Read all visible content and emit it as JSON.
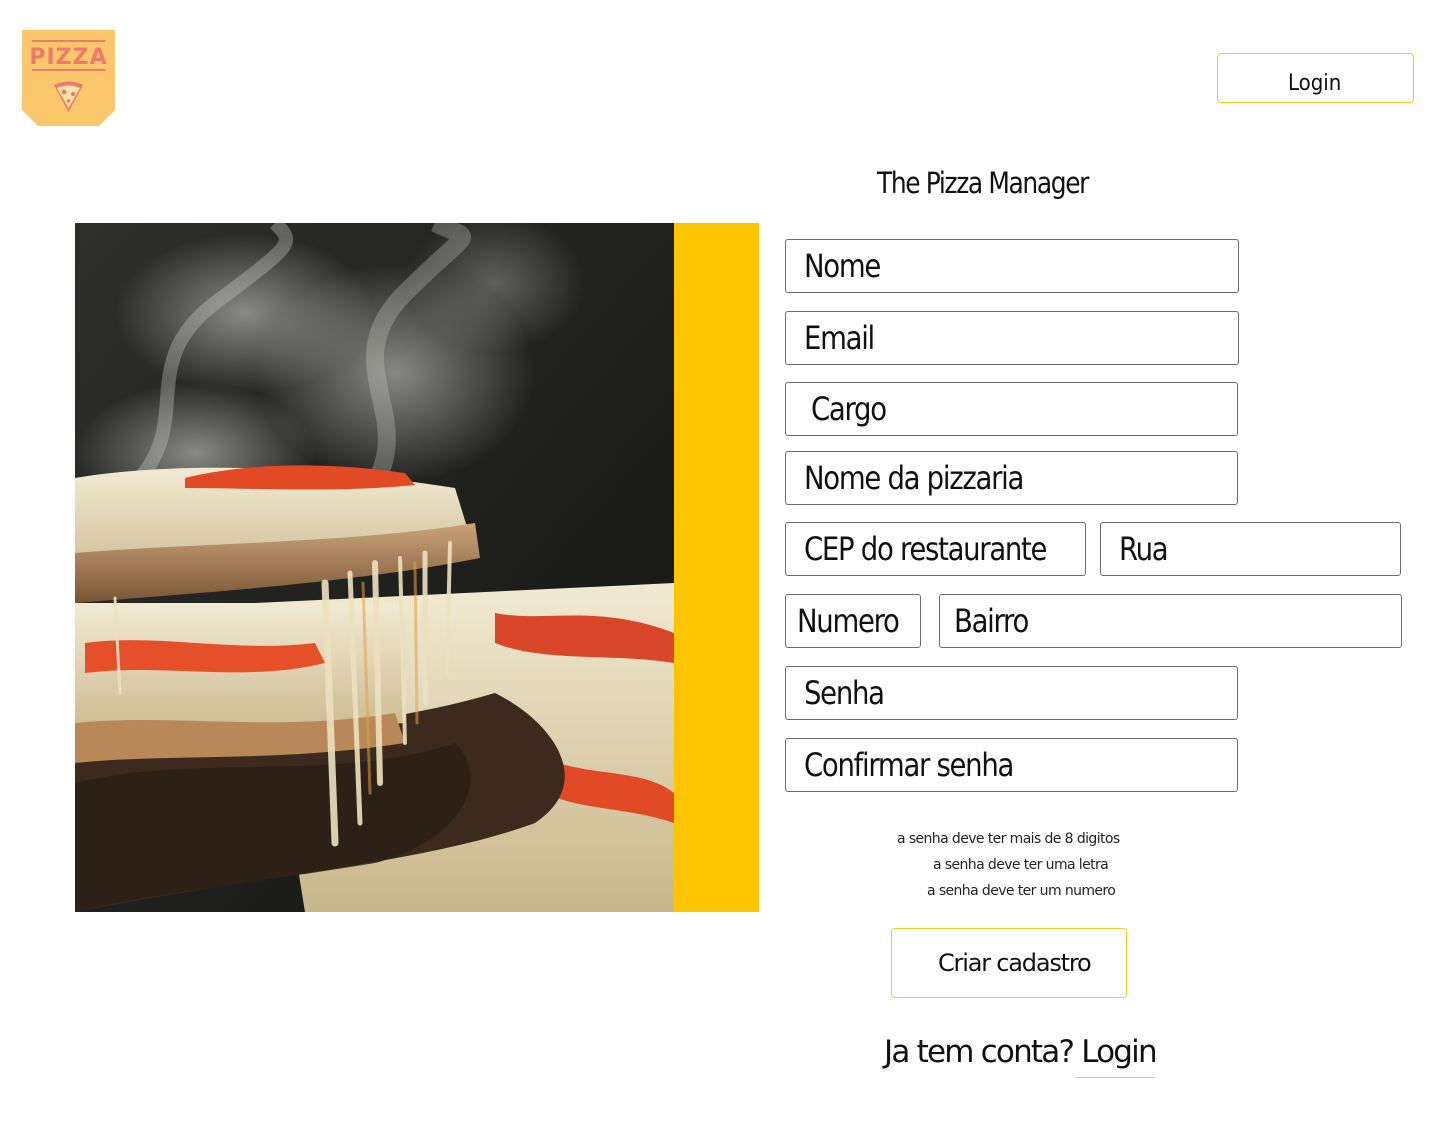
{
  "brand": {
    "logo_text": "PIZZA",
    "accent_color": "#fdc500",
    "button_border_color": "#f2cd1d"
  },
  "header": {
    "login_label": "Login"
  },
  "page": {
    "title": "The Pizza Manager"
  },
  "form": {
    "fields": {
      "nome": "Nome",
      "email": "Email",
      "cargo": "Cargo",
      "nome_pizzaria": "Nome da pizzaria",
      "cep": "CEP do restaurante",
      "rua": "Rua",
      "numero": "Numero",
      "bairro": "Bairro",
      "senha": "Senha",
      "confirmar_senha": "Confirmar senha"
    },
    "password_rules": [
      "a senha deve ter mais de 8 digitos",
      "a senha deve ter uma letra",
      "a senha deve ter um numero"
    ],
    "submit_label": "Criar cadastro"
  },
  "footer": {
    "question": "Ja tem conta? ",
    "login_link": "Login"
  }
}
